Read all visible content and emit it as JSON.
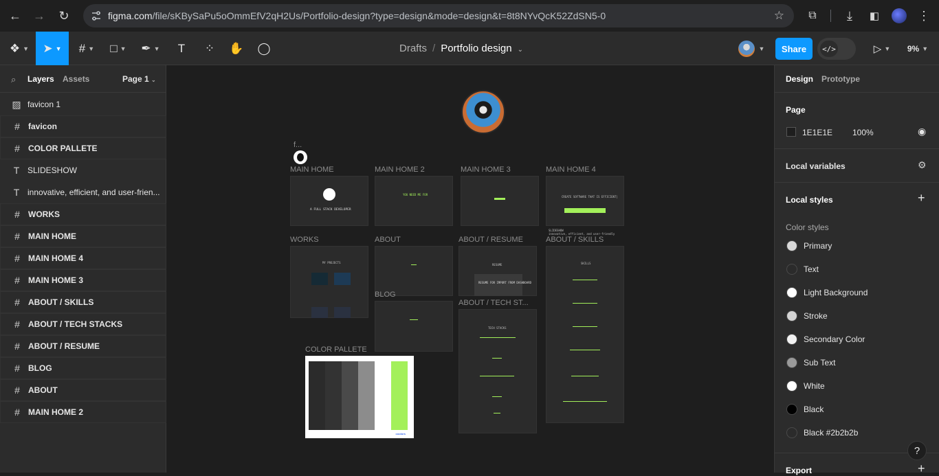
{
  "browser": {
    "url_host": "figma.com",
    "url_path": "/file/sKBySaPu5oOmmEfV2qH2Us/Portfolio-design?type=design&mode=design&t=8t8NYvQcK52ZdSN5-0"
  },
  "toolbar": {
    "breadcrumb_root": "Drafts",
    "file_title": "Portfolio design",
    "share_label": "Share",
    "zoom": "9%",
    "dev_mode_glyph": "</>"
  },
  "left_panel": {
    "tab_layers": "Layers",
    "tab_assets": "Assets",
    "page_select": "Page 1",
    "layers": [
      {
        "name": "favicon 1",
        "icon": "image-icon",
        "glyph": "▨",
        "frame": false
      },
      {
        "name": "favicon",
        "icon": "frame-icon",
        "glyph": "#",
        "frame": true
      },
      {
        "name": "COLOR PALLETE",
        "icon": "frame-icon",
        "glyph": "#",
        "frame": true
      },
      {
        "name": "SLIDESHOW",
        "icon": "text-icon",
        "glyph": "T",
        "frame": false
      },
      {
        "name": "innovative, efficient, and user-frien...",
        "icon": "text-icon",
        "glyph": "T",
        "frame": false
      },
      {
        "name": "WORKS",
        "icon": "frame-icon",
        "glyph": "#",
        "frame": true
      },
      {
        "name": "MAIN HOME",
        "icon": "frame-icon",
        "glyph": "#",
        "frame": true
      },
      {
        "name": "MAIN HOME 4",
        "icon": "frame-icon",
        "glyph": "#",
        "frame": true
      },
      {
        "name": "MAIN HOME 3",
        "icon": "frame-icon",
        "glyph": "#",
        "frame": true
      },
      {
        "name": "ABOUT / SKILLS",
        "icon": "frame-icon",
        "glyph": "#",
        "frame": true
      },
      {
        "name": "ABOUT / TECH STACKS",
        "icon": "frame-icon",
        "glyph": "#",
        "frame": true
      },
      {
        "name": "ABOUT / RESUME",
        "icon": "frame-icon",
        "glyph": "#",
        "frame": true
      },
      {
        "name": "BLOG",
        "icon": "frame-icon",
        "glyph": "#",
        "frame": true
      },
      {
        "name": "ABOUT",
        "icon": "frame-icon",
        "glyph": "#",
        "frame": true
      },
      {
        "name": "MAIN HOME 2",
        "icon": "frame-icon",
        "glyph": "#",
        "frame": true
      }
    ]
  },
  "canvas": {
    "favicon_label": "f...",
    "frame_labels": {
      "main_home": "MAIN HOME",
      "main_home_2": "MAIN HOME 2",
      "main_home_3": "MAIN HOME 3",
      "main_home_4": "MAIN HOME 4",
      "works": "WORKS",
      "about": "ABOUT",
      "about_resume": "ABOUT / RESUME",
      "about_skills": "ABOUT / SKILLS",
      "blog": "BLOG",
      "about_tech": "ABOUT / TECH ST...",
      "color_pallete": "COLOR PALLETE"
    },
    "mini_text": {
      "full_stack": "A FULL STACK DEVELOPER",
      "you_need": "YOU NEED ME FOR",
      "create_software": "CREATE SOFTWARE THAT IS EFFICIENT|",
      "slideshow": "SLIDESHOW",
      "slideshow_sub": "innovative, efficient, and user-friendly",
      "projects": "MY PROJECTS",
      "resume": "RESUME",
      "resume_body": "RESUME FOR IMPORT FROM DASHBOARD",
      "skills": "SKILLS",
      "tech_stacks": "TECH STACKS",
      "coolors": "coolors"
    },
    "palette_colors": [
      "#2b2b2b",
      "#333333",
      "#4a4a4a",
      "#8c8c8c",
      "#ffffff",
      "#a3f05a"
    ]
  },
  "right_panel": {
    "tab_design": "Design",
    "tab_prototype": "Prototype",
    "page_heading": "Page",
    "page_color": "1E1E1E",
    "page_opacity": "100%",
    "local_variables": "Local variables",
    "local_styles": "Local styles",
    "color_styles": "Color styles",
    "styles": [
      {
        "name": "Primary",
        "color": "#d9d9d9"
      },
      {
        "name": "Text",
        "color": "#2b2b2b"
      },
      {
        "name": "Light Background",
        "color": "#ffffff"
      },
      {
        "name": "Stroke",
        "color": "#d4d4d4"
      },
      {
        "name": "Secondary Color",
        "color": "#f2f2f2"
      },
      {
        "name": "Sub Text",
        "color": "#9a9a9a"
      },
      {
        "name": "White",
        "color": "#ffffff"
      },
      {
        "name": "Black",
        "color": "#000000"
      },
      {
        "name": "Black #2b2b2b",
        "color": "#2b2b2b"
      }
    ],
    "export": "Export",
    "help": "?"
  }
}
